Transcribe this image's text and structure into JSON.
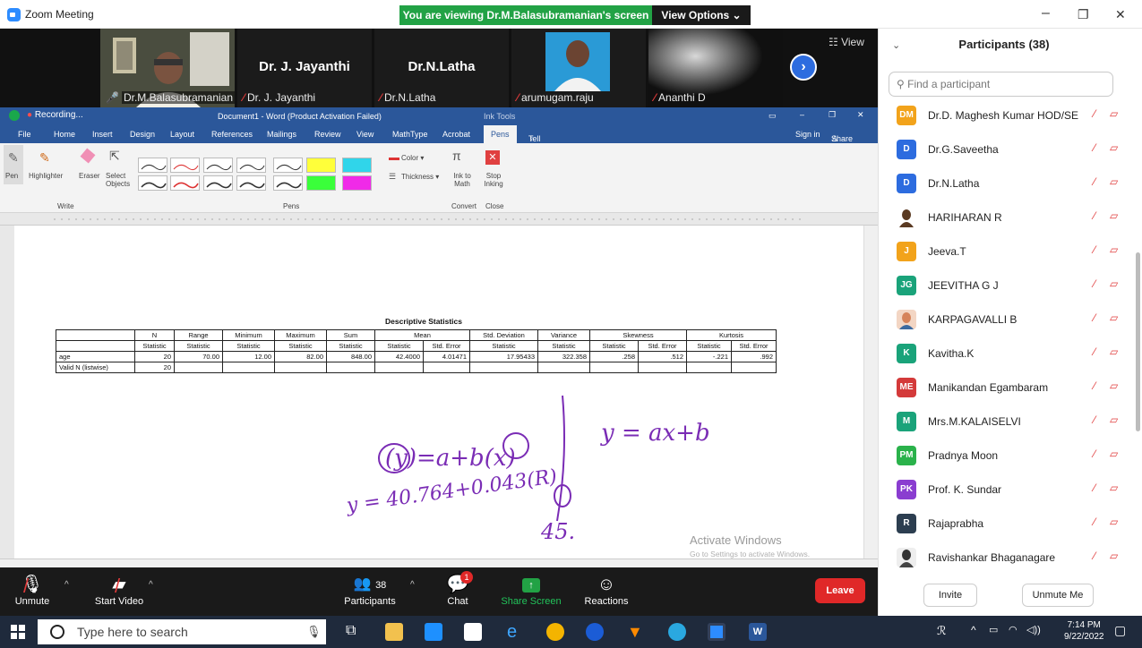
{
  "window": {
    "app_title": "Zoom Meeting",
    "viewing_banner": "You are viewing Dr.M.Balasubramanian's screen",
    "view_options": "View Options ⌄",
    "min": "–",
    "max": "❐",
    "close": "✕"
  },
  "video_strip": {
    "view_label": "☷ View",
    "tiles": [
      {
        "name": "Dr.M.Balasubramanian",
        "big": ""
      },
      {
        "name": "Dr. J. Jayanthi",
        "big": "Dr. J. Jayanthi"
      },
      {
        "name": "Dr.N.Latha",
        "big": "Dr.N.Latha"
      },
      {
        "name": "arumugam.raju",
        "big": ""
      },
      {
        "name": "Ananthi  D",
        "big": ""
      }
    ]
  },
  "word": {
    "recording": "Recording...",
    "doc_title": "Document1 - Word (Product Activation Failed)",
    "ink_tools": "Ink Tools",
    "tabs": [
      "File",
      "Home",
      "Insert",
      "Design",
      "Layout",
      "References",
      "Mailings",
      "Review",
      "View",
      "MathType",
      "Acrobat",
      "Pens"
    ],
    "tell_me": "Tell me what you want to do...",
    "sign_in": "Sign in",
    "share": "Share",
    "ribbon": {
      "pen": "Pen",
      "highlighter": "Highlighter",
      "eraser": "Eraser",
      "select": "Select Objects",
      "write_group": "Write",
      "pens_group": "Pens",
      "color": "Color ▾",
      "thickness": "Thickness ▾",
      "ink_to_math": "Ink to Math",
      "stop_inking": "Stop Inking",
      "convert_group": "Convert",
      "close_group": "Close"
    }
  },
  "stats_table": {
    "title": "Descriptive Statistics",
    "header1": [
      "",
      "N",
      "Range",
      "Minimum",
      "Maximum",
      "Sum",
      "Mean",
      "Std. Deviation",
      "Variance",
      "Skewness",
      "Kurtosis"
    ],
    "header2": [
      "",
      "Statistic",
      "Statistic",
      "Statistic",
      "Statistic",
      "Statistic",
      "Statistic",
      "Std. Error",
      "Statistic",
      "Statistic",
      "Statistic",
      "Std. Error",
      "Statistic",
      "Std. Error"
    ],
    "row_age": [
      "age",
      "20",
      "70.00",
      "12.00",
      "82.00",
      "848.00",
      "42.4000",
      "4.01471",
      "17.95433",
      "322.358",
      ".258",
      ".512",
      "-.221",
      ".992"
    ],
    "row_valid": [
      "Valid N (listwise)",
      "20"
    ]
  },
  "handwriting": {
    "line1": "(y)=a+b(x)",
    "line2": "y = ax+b",
    "line3": "y = 40.764+0.043(R)",
    "line4": "45."
  },
  "watermark": {
    "line1": "Activate Windows",
    "line2": "Go to Settings to activate Windows."
  },
  "toolbar": {
    "unmute": "Unmute",
    "start_video": "Start Video",
    "participants": "Participants",
    "participants_count": "38",
    "chat": "Chat",
    "chat_badge": "1",
    "share_screen": "Share Screen",
    "reactions": "Reactions",
    "leave": "Leave"
  },
  "panel": {
    "title": "Participants (38)",
    "search_placeholder": "Find a participant",
    "participants": [
      {
        "initials": "DM",
        "name": "Dr.D. Maghesh Kumar HOD/SE",
        "color": "#f2a31b"
      },
      {
        "initials": "D",
        "name": "Dr.G.Saveetha",
        "color": "#2d6cdf"
      },
      {
        "initials": "D",
        "name": "Dr.N.Latha",
        "color": "#2d6cdf"
      },
      {
        "initials": "",
        "name": "HARIHARAN R",
        "color": "#5a3a22"
      },
      {
        "initials": "J",
        "name": "Jeeva.T",
        "color": "#f2a31b"
      },
      {
        "initials": "JG",
        "name": "JEEVITHA G J",
        "color": "#1aa37a"
      },
      {
        "initials": "",
        "name": "KARPAGAVALLI B",
        "color": "#d6835a"
      },
      {
        "initials": "K",
        "name": "Kavitha.K",
        "color": "#1aa37a"
      },
      {
        "initials": "ME",
        "name": "Manikandan Egambaram",
        "color": "#d43a3a"
      },
      {
        "initials": "M",
        "name": "Mrs.M.KALAISELVI",
        "color": "#1aa37a"
      },
      {
        "initials": "PM",
        "name": "Pradnya  Moon",
        "color": "#2ab24b"
      },
      {
        "initials": "PK",
        "name": "Prof. K. Sundar",
        "color": "#8a3dd0"
      },
      {
        "initials": "R",
        "name": "Rajaprabha",
        "color": "#2c3e50"
      },
      {
        "initials": "",
        "name": "Ravishankar Bhaganagare",
        "color": "#333333"
      }
    ],
    "invite": "Invite",
    "unmute_me": "Unmute Me"
  },
  "taskbar": {
    "search_placeholder": "Type here to search",
    "time": "7:14 PM",
    "date": "9/22/2022"
  }
}
